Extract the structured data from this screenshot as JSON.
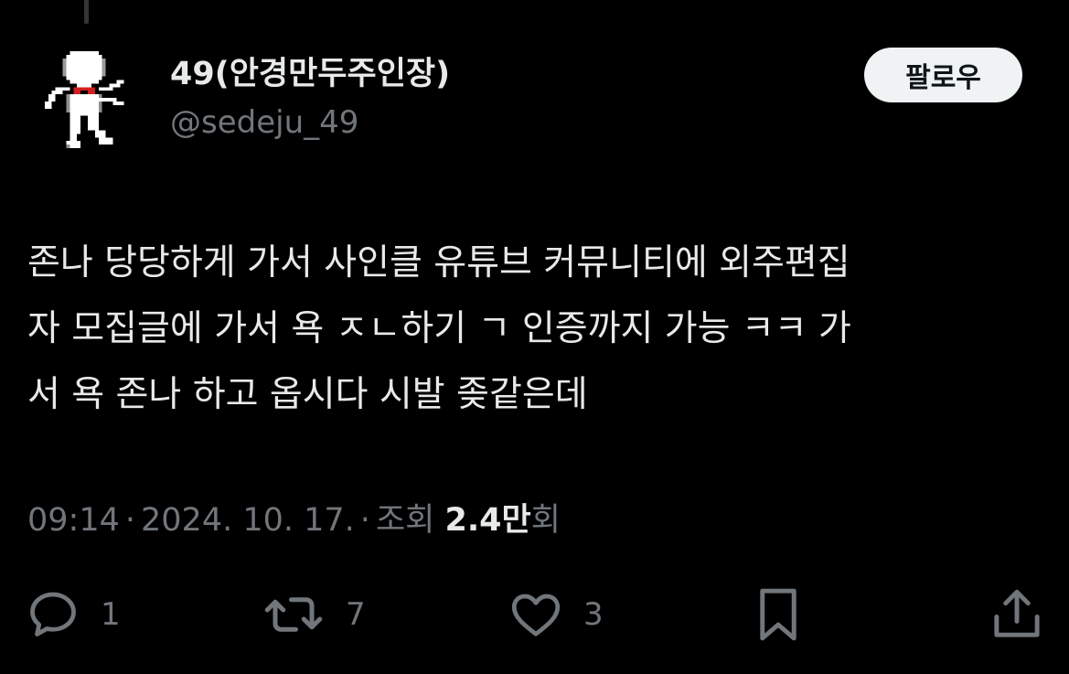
{
  "user": {
    "display_name": "49(안경만두주인장)",
    "handle": "@sedeju_49",
    "avatar_icon": "pixel-character-avatar"
  },
  "follow_button": {
    "label": "팔로우"
  },
  "tweet": {
    "text": "존나 당당하게 가서 사인클 유튜브 커뮤니티에 외주편집\n자 모집글에 가서 욕 ㅈㄴ하기 ㄱ 인증까지 가능 ㅋㅋ 가\n서 욕 존나 하고 옵시다 시발 좆같은데"
  },
  "meta": {
    "time": "09:14",
    "date": "2024. 10. 17.",
    "views_label": "조회",
    "views_count": "2.4만",
    "views_suffix": "회",
    "separator": "·"
  },
  "actions": {
    "reply": {
      "icon": "reply-icon",
      "count": "1"
    },
    "retweet": {
      "icon": "retweet-icon",
      "count": "7"
    },
    "like": {
      "icon": "heart-icon",
      "count": "3"
    },
    "bookmark": {
      "icon": "bookmark-icon"
    },
    "share": {
      "icon": "share-icon"
    }
  },
  "colors": {
    "background": "#000000",
    "primary_text": "#e7e9ea",
    "secondary_text": "#71767b",
    "follow_button_bg": "#eff3f4",
    "follow_button_text": "#0f1419"
  }
}
